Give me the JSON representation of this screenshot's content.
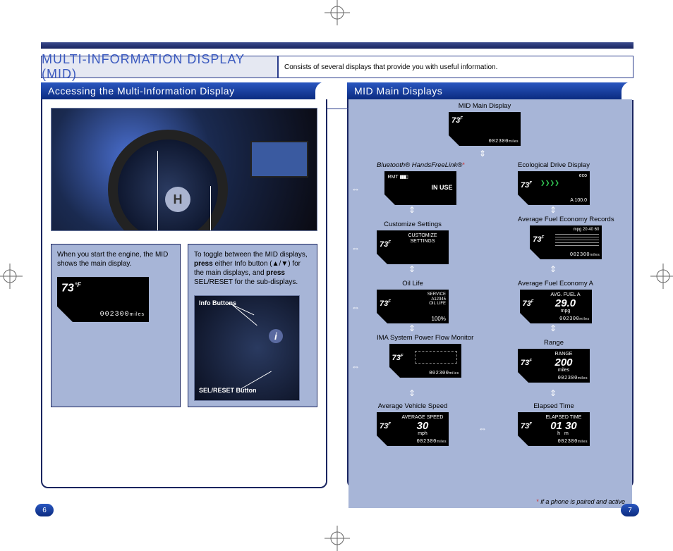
{
  "title": "MULTI-INFORMATION DISPLAY (MID)",
  "intro": "Consists of several displays that provide you with useful information.",
  "left": {
    "section": "Accessing the Multi-Information Display",
    "callout_start": "When you start the engine, the MID shows the main display.",
    "callout_toggle_parts": {
      "a": "To toggle between the MID displays, ",
      "b": "press",
      "c": " either Info button (",
      "d": "▲/▼",
      "e": ") for the main displays, and ",
      "f": "press",
      "g": " SEL/RESET for the sub-displays."
    },
    "info_buttons": "Info Buttons",
    "sel_reset": "SEL/RESET Button",
    "temp": "73",
    "temp_unit": "°F",
    "odo": "002300",
    "odo_unit": "miles"
  },
  "right": {
    "section": "MID Main Displays",
    "nodes": {
      "main": "MID Main Display",
      "bt": "Bluetooth® HandsFreeLink®",
      "bt_in_use": "IN USE",
      "bt_rmt": "RMT",
      "eco": "Ecological Drive Display",
      "eco_label": "eco",
      "eco_val": "A   100.0",
      "cust": "Customize Settings",
      "cust_l1": "CUSTOMIZE",
      "cust_l2": "SETTINGS",
      "afe_rec": "Average Fuel Economy Records",
      "afe_rec_scale": "mpg 20 40 60",
      "oil": "Oil Life",
      "oil_l1": "SERVICE",
      "oil_l2": "A12345",
      "oil_l3": "OIL LIFE",
      "oil_pct": "100%",
      "afe_a": "Average Fuel Economy A",
      "afe_a_lbl": "AVG. FUEL A",
      "afe_a_val": "29.0",
      "afe_a_unit": "mpg",
      "ima": "IMA System Power Flow Monitor",
      "range": "Range",
      "range_lbl": "RANGE",
      "range_val": "200",
      "range_unit": "miles",
      "avs": "Average Vehicle Speed",
      "avs_lbl": "AVERAGE SPEED",
      "avs_val": "30",
      "avs_unit": "mph",
      "elapsed": "Elapsed Time",
      "elapsed_lbl": "ELAPSED TIME",
      "elapsed_val": "01 30",
      "elapsed_unit": "h        m"
    },
    "temp": "73",
    "temp_unit": "F",
    "odo": "002300",
    "odo_unit": "miles",
    "footnote": "if a phone is paired and active"
  },
  "pages": {
    "left": "6",
    "right": "7"
  }
}
